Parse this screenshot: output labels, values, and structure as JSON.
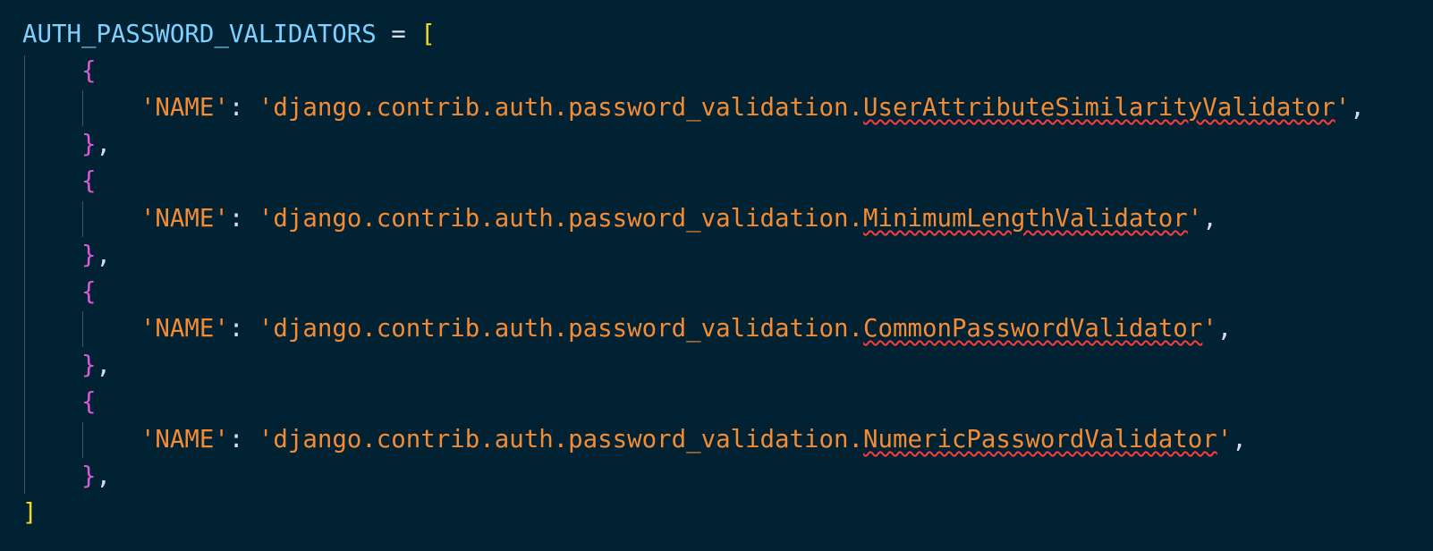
{
  "code": {
    "variable": "AUTH_PASSWORD_VALIDATORS",
    "assign": " = ",
    "open_bracket": "[",
    "close_bracket": "]",
    "open_brace": "{",
    "close_brace": "}",
    "comma": ",",
    "colon": ": ",
    "key": "'NAME'",
    "module_prefix": "'django.contrib.auth.password_validation.",
    "string_end": "'",
    "validators": [
      "UserAttributeSimilarityValidator",
      "MinimumLengthValidator",
      "CommonPasswordValidator",
      "NumericPasswordValidator"
    ]
  },
  "colors": {
    "background": "#012233",
    "variable": "#7fd1ff",
    "bracket": "#f4d81d",
    "brace": "#d85ad6",
    "string": "#f58b33",
    "error_underline": "#ff3b3b"
  }
}
